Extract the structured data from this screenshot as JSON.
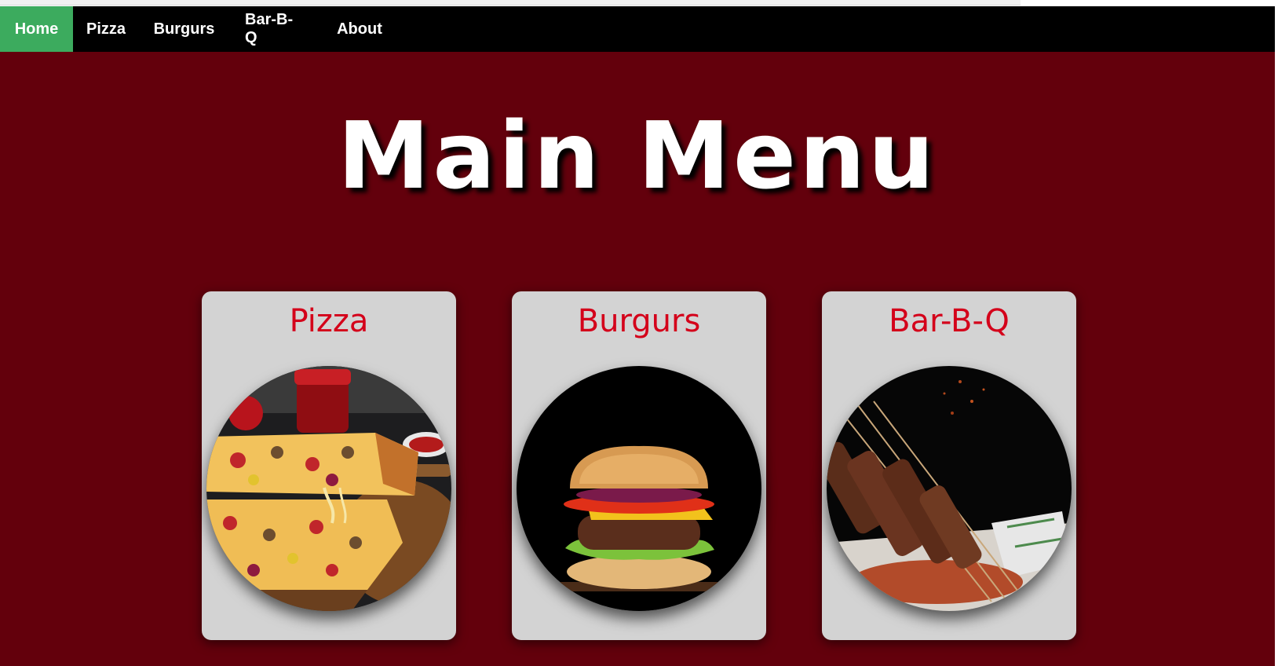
{
  "nav": {
    "items": [
      {
        "label": "Home",
        "active": true
      },
      {
        "label": "Pizza",
        "active": false
      },
      {
        "label": "Burgurs",
        "active": false
      },
      {
        "label": "Bar-B-Q",
        "active": false
      },
      {
        "label": "About",
        "active": false
      }
    ]
  },
  "main": {
    "title": "Main Menu",
    "cards": [
      {
        "title": "Pizza",
        "image": "pizza-photo"
      },
      {
        "title": "Burgurs",
        "image": "burger-photo"
      },
      {
        "title": "Bar-B-Q",
        "image": "bbq-skewers-photo"
      }
    ]
  },
  "colors": {
    "page_background": "#63000c",
    "navbar_background": "#000000",
    "active_nav_background": "#3cab5e",
    "card_background": "#d3d3d3",
    "card_title": "#d4001a",
    "title_text": "#ffffff"
  }
}
